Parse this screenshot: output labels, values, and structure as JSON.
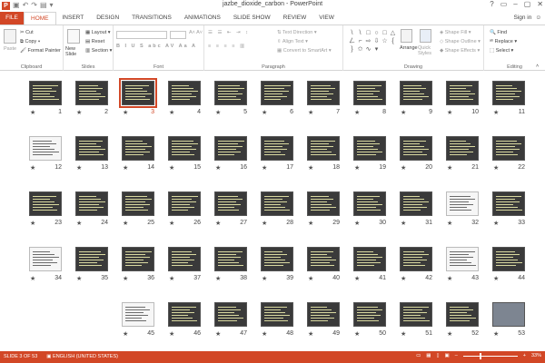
{
  "app": {
    "title": "jazbe_dioxide_carbon - PowerPoint",
    "window_controls": [
      "?",
      "▭",
      "–",
      "▢",
      "✕"
    ],
    "signin": "Sign in"
  },
  "tabs": [
    "FILE",
    "HOME",
    "INSERT",
    "DESIGN",
    "TRANSITIONS",
    "ANIMATIONS",
    "SLIDE SHOW",
    "REVIEW",
    "VIEW"
  ],
  "active_tab": "HOME",
  "ribbon": {
    "clipboard": {
      "label": "Clipboard",
      "paste": "Paste",
      "cut": "Cut",
      "copy": "Copy",
      "format_painter": "Format Painter"
    },
    "slides": {
      "label": "Slides",
      "new_slide": "New Slide",
      "layout": "Layout",
      "reset": "Reset",
      "section": "Section"
    },
    "font": {
      "label": "Font"
    },
    "paragraph": {
      "label": "Paragraph",
      "text_direction": "Text Direction",
      "align_text": "Align Text",
      "convert_smartart": "Convert to SmartArt"
    },
    "drawing": {
      "label": "Drawing",
      "arrange": "Arrange",
      "quick_styles": "Quick Styles",
      "shape_fill": "Shape Fill",
      "shape_outline": "Shape Outline",
      "shape_effects": "Shape Effects"
    },
    "editing": {
      "label": "Editing",
      "find": "Find",
      "replace": "Replace",
      "select": "Select"
    }
  },
  "slides": [
    {
      "n": "11"
    },
    {
      "n": "10"
    },
    {
      "n": "9"
    },
    {
      "n": "8"
    },
    {
      "n": "7"
    },
    {
      "n": "6"
    },
    {
      "n": "5"
    },
    {
      "n": "4"
    },
    {
      "n": "3",
      "selected": true
    },
    {
      "n": "2"
    },
    {
      "n": "1"
    },
    {
      "n": "22"
    },
    {
      "n": "21"
    },
    {
      "n": "20"
    },
    {
      "n": "19"
    },
    {
      "n": "18"
    },
    {
      "n": "17"
    },
    {
      "n": "16"
    },
    {
      "n": "15"
    },
    {
      "n": "14"
    },
    {
      "n": "13"
    },
    {
      "n": "12",
      "light": true
    },
    {
      "n": "33"
    },
    {
      "n": "32",
      "light": true
    },
    {
      "n": "31"
    },
    {
      "n": "30"
    },
    {
      "n": "29"
    },
    {
      "n": "28"
    },
    {
      "n": "27"
    },
    {
      "n": "26"
    },
    {
      "n": "25"
    },
    {
      "n": "24"
    },
    {
      "n": "23"
    },
    {
      "n": "44"
    },
    {
      "n": "43",
      "light": true
    },
    {
      "n": "42"
    },
    {
      "n": "41"
    },
    {
      "n": "40"
    },
    {
      "n": "39"
    },
    {
      "n": "38"
    },
    {
      "n": "37"
    },
    {
      "n": "36"
    },
    {
      "n": "35"
    },
    {
      "n": "34",
      "light": true
    },
    {
      "n": "53",
      "photo": true
    },
    {
      "n": "52"
    },
    {
      "n": "51"
    },
    {
      "n": "50"
    },
    {
      "n": "49"
    },
    {
      "n": "48"
    },
    {
      "n": "47"
    },
    {
      "n": "46"
    },
    {
      "n": "45",
      "light": true
    }
  ],
  "status": {
    "slide_info": "SLIDE 3 OF 53",
    "language": "ENGLISH (UNITED STATES)",
    "zoom": "33%"
  },
  "colors": {
    "accent": "#d24726"
  }
}
